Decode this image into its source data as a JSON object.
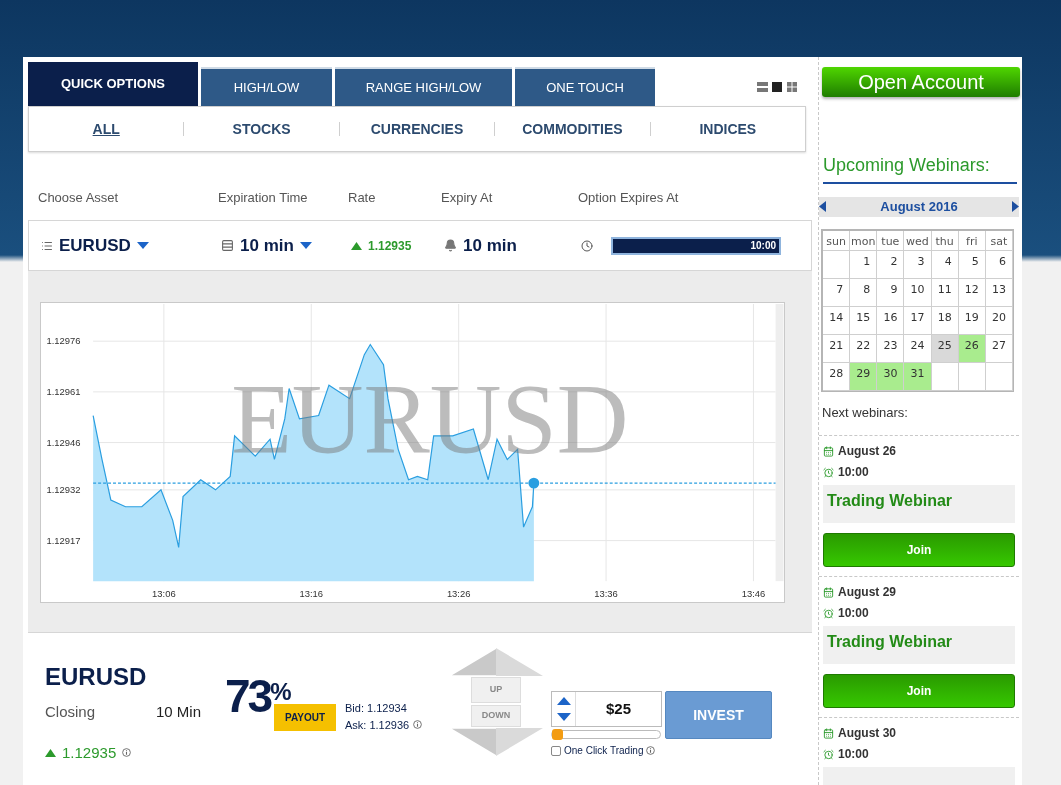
{
  "option_tabs": [
    {
      "label": "QUICK OPTIONS",
      "selected": true
    },
    {
      "label": "HIGH/LOW",
      "selected": false
    },
    {
      "label": "RANGE HIGH/LOW",
      "selected": false
    },
    {
      "label": "ONE TOUCH",
      "selected": false
    }
  ],
  "view_modes": [
    {
      "kind": "list",
      "selected": false
    },
    {
      "kind": "single",
      "selected": true
    },
    {
      "kind": "grid",
      "selected": false
    }
  ],
  "categories": [
    {
      "label": "ALL",
      "selected": true
    },
    {
      "label": "STOCKS",
      "selected": false
    },
    {
      "label": "CURRENCIES",
      "selected": false
    },
    {
      "label": "COMMODITIES",
      "selected": false
    },
    {
      "label": "INDICES",
      "selected": false
    }
  ],
  "headers": [
    "Choose Asset",
    "Expiration Time",
    "Rate",
    "Expiry At",
    "Option Expires At"
  ],
  "selectors": {
    "asset": "EURUSD",
    "expiration": "10 min",
    "rate": "1.12935",
    "expiry_at": "10 min",
    "countdown": {
      "text": "10:00",
      "level": 1
    }
  },
  "chart": {
    "background_label": "EURUSD",
    "chart_data": {
      "type": "area",
      "grid": true,
      "ref_lines": [
        {
          "axis": "y",
          "value": 1.12934
        }
      ],
      "xlim": [
        781.2,
        827.5
      ],
      "ylim": [
        1.12905,
        1.12987
      ],
      "xticks": [
        {
          "value": 786,
          "label": "13:06"
        },
        {
          "value": 796,
          "label": "13:16"
        },
        {
          "value": 806,
          "label": "13:26"
        },
        {
          "value": 816,
          "label": "13:36"
        },
        {
          "value": 826,
          "label": "13:46"
        }
      ],
      "yticks": [
        1.12917,
        1.12932,
        1.12946,
        1.12961,
        1.12976
      ],
      "x": [
        781.2,
        781.8,
        782.4,
        783.4,
        784.5,
        785.8,
        786.6,
        787.0,
        787.3,
        788.5,
        789.5,
        790.5,
        790.8,
        792.2,
        793.2,
        793.5,
        794.2,
        794.5,
        795.2,
        796.5,
        797.2,
        798.6,
        799.6,
        800.0,
        800.9,
        801.2,
        801.9,
        802.6,
        803.2,
        803.9,
        804.3,
        805.6,
        807.0,
        808.0,
        808.6,
        809.3,
        810.0,
        810.4,
        811.0,
        811.1
      ],
      "series": [
        {
          "color": "#2a9ee0",
          "values": [
            1.12954,
            1.12941,
            1.12929,
            1.12927,
            1.12927,
            1.12932,
            1.12923,
            1.12915,
            1.1293,
            1.12935,
            1.12932,
            1.12936,
            1.12948,
            1.12942,
            1.12947,
            1.12941,
            1.12953,
            1.12962,
            1.12953,
            1.12954,
            1.12963,
            1.12959,
            1.12972,
            1.12975,
            1.12969,
            1.12959,
            1.12944,
            1.12935,
            1.12936,
            1.12935,
            1.12948,
            1.12948,
            1.1295,
            1.12935,
            1.12947,
            1.12941,
            1.12944,
            1.12921,
            1.12927,
            1.12934
          ]
        }
      ]
    }
  },
  "trade": {
    "asset": "EURUSD",
    "closing_label": "Closing",
    "closing_value": "10 Min",
    "rate": "1.12935",
    "payout": "73$^{%}$",
    "payout_label": "PAYOUT",
    "bid": "Bid: 1.12934",
    "ask": "Ask: 1.12936",
    "up": "UP",
    "down": "DOWN",
    "amount": "$25",
    "amount_level": {
      "level": 0
    },
    "one_click": {
      "label": "One Click Trading",
      "checked": false
    },
    "invest": "INVEST"
  },
  "sidebar": {
    "open_account": "Open Account",
    "webinars_title": "Upcoming Webinars:",
    "calendar": {
      "month": "August 2016",
      "weekdays": [
        "sun",
        "mon",
        "tue",
        "wed",
        "thu",
        "fri",
        "sat"
      ],
      "weeks": [
        [
          {
            "kind": "blank"
          },
          {
            "kind": "day",
            "day": "1",
            "selected": false,
            "has_webinar": false
          },
          {
            "kind": "day",
            "day": "2",
            "selected": false,
            "has_webinar": false
          },
          {
            "kind": "day",
            "day": "3",
            "selected": false,
            "has_webinar": false
          },
          {
            "kind": "day",
            "day": "4",
            "selected": false,
            "has_webinar": false
          },
          {
            "kind": "day",
            "day": "5",
            "selected": false,
            "has_webinar": false
          },
          {
            "kind": "day",
            "day": "6",
            "selected": false,
            "has_webinar": false
          }
        ],
        [
          {
            "kind": "day",
            "day": "7",
            "selected": false,
            "has_webinar": false
          },
          {
            "kind": "day",
            "day": "8",
            "selected": false,
            "has_webinar": false
          },
          {
            "kind": "day",
            "day": "9",
            "selected": false,
            "has_webinar": false
          },
          {
            "kind": "day",
            "day": "10",
            "selected": false,
            "has_webinar": false
          },
          {
            "kind": "day",
            "day": "11",
            "selected": false,
            "has_webinar": false
          },
          {
            "kind": "day",
            "day": "12",
            "selected": false,
            "has_webinar": false
          },
          {
            "kind": "day",
            "day": "13",
            "selected": false,
            "has_webinar": false
          }
        ],
        [
          {
            "kind": "day",
            "day": "14",
            "selected": false,
            "has_webinar": false
          },
          {
            "kind": "day",
            "day": "15",
            "selected": false,
            "has_webinar": false
          },
          {
            "kind": "day",
            "day": "16",
            "selected": false,
            "has_webinar": false
          },
          {
            "kind": "day",
            "day": "17",
            "selected": false,
            "has_webinar": false
          },
          {
            "kind": "day",
            "day": "18",
            "selected": false,
            "has_webinar": false
          },
          {
            "kind": "day",
            "day": "19",
            "selected": false,
            "has_webinar": false
          },
          {
            "kind": "day",
            "day": "20",
            "selected": false,
            "has_webinar": false
          }
        ],
        [
          {
            "kind": "day",
            "day": "21",
            "selected": false,
            "has_webinar": false
          },
          {
            "kind": "day",
            "day": "22",
            "selected": false,
            "has_webinar": false
          },
          {
            "kind": "day",
            "day": "23",
            "selected": false,
            "has_webinar": false
          },
          {
            "kind": "day",
            "day": "24",
            "selected": false,
            "has_webinar": false
          },
          {
            "kind": "day",
            "day": "25",
            "selected": true,
            "has_webinar": false
          },
          {
            "kind": "day",
            "day": "26",
            "selected": false,
            "has_webinar": true
          },
          {
            "kind": "day",
            "day": "27",
            "selected": false,
            "has_webinar": false
          }
        ],
        [
          {
            "kind": "day",
            "day": "28",
            "selected": false,
            "has_webinar": false
          },
          {
            "kind": "day",
            "day": "29",
            "selected": false,
            "has_webinar": true
          },
          {
            "kind": "day",
            "day": "30",
            "selected": false,
            "has_webinar": true
          },
          {
            "kind": "day",
            "day": "31",
            "selected": false,
            "has_webinar": true
          },
          {
            "kind": "blank"
          },
          {
            "kind": "blank"
          },
          {
            "kind": "blank"
          }
        ]
      ]
    },
    "next_label": "Next webinars:",
    "webinars": [
      {
        "date": "August 26",
        "time": "10:00",
        "title": "Trading Webinar",
        "button": "Join"
      },
      {
        "date": "August 29",
        "time": "10:00",
        "title": "Trading Webinar",
        "button": "Join"
      },
      {
        "date": "August 30",
        "time": "10:00"
      }
    ]
  }
}
